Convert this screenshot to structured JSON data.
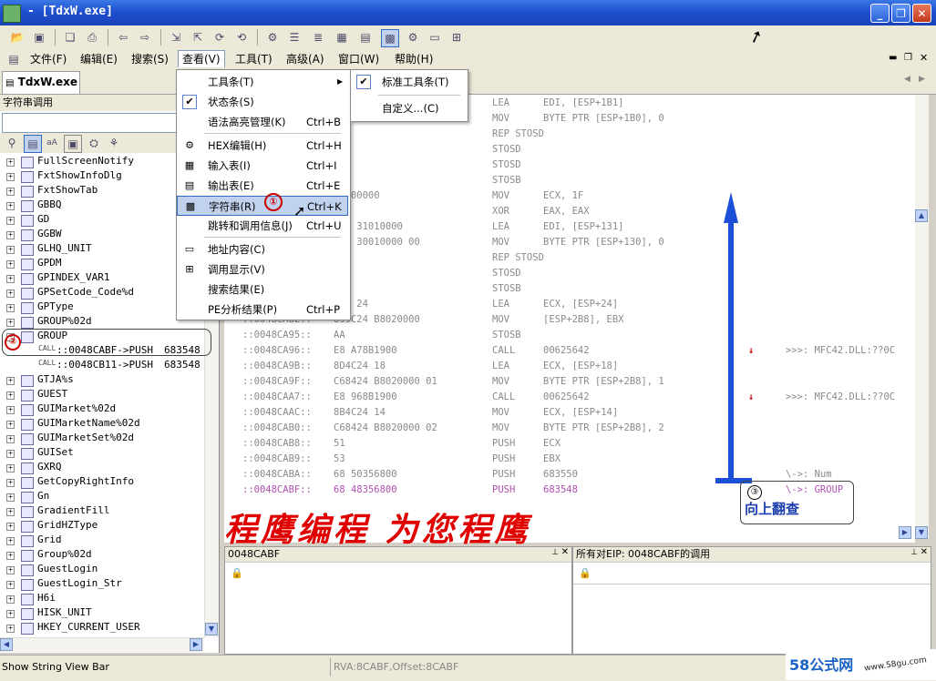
{
  "window": {
    "title": "- [TdxW.exe]"
  },
  "menubar": [
    "文件(F)",
    "编辑(E)",
    "搜索(S)",
    "查看(V)",
    "工具(T)",
    "高级(A)",
    "窗口(W)",
    "帮助(H)"
  ],
  "doc_tab": "TdxW.exe",
  "left_panel": {
    "title": "字符串调用",
    "tree": [
      "FullScreenNotify",
      "FxtShowInfoDlg",
      "FxtShowTab",
      "GBBQ",
      "GD",
      "GGBW",
      "GLHQ_UNIT",
      "GPDM",
      "GPINDEX_VAR1",
      "GPSetCode_Code%d",
      "GPType",
      "GROUP%02d"
    ],
    "group_label": "GROUP",
    "group_children": [
      {
        "tag": "CALL",
        "text": "::0048CABF->PUSH",
        "value": "683548"
      },
      {
        "tag": "CALL",
        "text": "::0048CB11->PUSH",
        "value": "683548"
      }
    ],
    "tree_after": [
      "GTJA%s",
      "GUEST",
      "GUIMarket%02d",
      "GUIMarketName%02d",
      "GUIMarketSet%02d",
      "GUISet",
      "GXRQ",
      "GetCopyRightInfo",
      "Gn",
      "GradientFill",
      "GridHZType",
      "Grid",
      "Group%02d",
      "GuestLogin",
      "GuestLogin_Str",
      "H6i",
      "HISK_UNIT",
      "HKEY_CURRENT_USER"
    ]
  },
  "view_menu": {
    "items": [
      {
        "label": "工具条(T)",
        "shortcut": "",
        "icon": "arrow-right-icon",
        "kind": "submenu"
      },
      {
        "label": "状态条(S)",
        "shortcut": "",
        "icon": "check-icon",
        "kind": "check"
      },
      {
        "label": "语法高亮管理(K)",
        "shortcut": "Ctrl+B",
        "icon": "",
        "kind": "plain"
      },
      {
        "label": "HEX编辑(H)",
        "shortcut": "Ctrl+H",
        "icon": "hex-icon",
        "kind": "plain"
      },
      {
        "label": "输入表(I)",
        "shortcut": "Ctrl+I",
        "icon": "import-icon",
        "kind": "plain"
      },
      {
        "label": "输出表(E)",
        "shortcut": "Ctrl+E",
        "icon": "export-icon",
        "kind": "plain"
      },
      {
        "label": "字符串(R)",
        "shortcut": "Ctrl+K",
        "icon": "string-icon",
        "kind": "highlight"
      },
      {
        "label": "跳转和调用信息(J)",
        "shortcut": "Ctrl+U",
        "icon": "",
        "kind": "plain"
      },
      {
        "label": "地址内容(C)",
        "shortcut": "",
        "icon": "address-icon",
        "kind": "plain"
      },
      {
        "label": "调用显示(V)",
        "shortcut": "",
        "icon": "call-icon",
        "kind": "plain"
      },
      {
        "label": "搜索结果(E)",
        "shortcut": "",
        "icon": "",
        "kind": "plain"
      },
      {
        "label": "PE分析结果(P)",
        "shortcut": "Ctrl+P",
        "icon": "",
        "kind": "plain"
      }
    ]
  },
  "submenu": {
    "items": [
      "标准工具条(T)",
      "自定义...(C)"
    ]
  },
  "code": [
    {
      "addr": "",
      "bytes": "",
      "mn": "LEA",
      "op": "EDI, [ESP+1B1]",
      "cmt": ""
    },
    {
      "addr": "",
      "bytes": "",
      "mn": "MOV",
      "op": "BYTE PTR [ESP+1B0], 0",
      "cmt": ""
    },
    {
      "addr": "",
      "bytes": "",
      "mn": "REP STOSD",
      "op": "",
      "cmt": ""
    },
    {
      "addr": "",
      "bytes": "",
      "mn": "STOSD",
      "op": "",
      "cmt": ""
    },
    {
      "addr": "",
      "bytes": "AB",
      "mn": "STOSD",
      "op": "",
      "cmt": ""
    },
    {
      "addr": "",
      "bytes": "",
      "mn": "STOSB",
      "op": "",
      "cmt": ""
    },
    {
      "addr": "",
      "bytes": "1F000000",
      "mn": "MOV",
      "op": "ECX, 1F",
      "cmt": ""
    },
    {
      "addr": "",
      "bytes": "",
      "mn": "XOR",
      "op": "EAX, EAX",
      "cmt": ""
    },
    {
      "addr": "",
      "bytes": "C24 31010000",
      "mn": "LEA",
      "op": "EDI, [ESP+131]",
      "cmt": ""
    },
    {
      "addr": "",
      "bytes": "424 30010000 00",
      "mn": "MOV",
      "op": "BYTE PTR [ESP+130], 0",
      "cmt": ""
    },
    {
      "addr": "",
      "bytes": "",
      "mn": "REP STOSD",
      "op": "",
      "cmt": ""
    },
    {
      "addr": "",
      "bytes": "",
      "mn": "STOSD",
      "op": "",
      "cmt": ""
    },
    {
      "addr": "",
      "bytes": "AB",
      "mn": "STOSB",
      "op": "",
      "cmt": ""
    },
    {
      "addr": "",
      "bytes": "C24 24",
      "mn": "LEA",
      "op": "ECX, [ESP+24]",
      "cmt": ""
    },
    {
      "addr": "::0048CA8E::",
      "bytes": "899C24 B8020000",
      "mn": "MOV",
      "op": "[ESP+2B8], EBX",
      "cmt": ""
    },
    {
      "addr": "::0048CA95::",
      "bytes": "AA",
      "mn": "STOSB",
      "op": "",
      "cmt": ""
    },
    {
      "addr": "::0048CA96::",
      "bytes": "E8 A78B1900",
      "mn": "CALL",
      "op": "00625642",
      "cmt": ">>>: MFC42.DLL:??0C"
    },
    {
      "addr": "::0048CA9B::",
      "bytes": "8D4C24 18",
      "mn": "LEA",
      "op": "ECX, [ESP+18]",
      "cmt": ""
    },
    {
      "addr": "::0048CA9F::",
      "bytes": "C68424 B8020000 01",
      "mn": "MOV",
      "op": "BYTE PTR [ESP+2B8], 1",
      "cmt": ""
    },
    {
      "addr": "::0048CAA7::",
      "bytes": "E8 968B1900",
      "mn": "CALL",
      "op": "00625642",
      "cmt": ">>>: MFC42.DLL:??0C"
    },
    {
      "addr": "::0048CAAC::",
      "bytes": "8B4C24 14",
      "mn": "MOV",
      "op": "ECX, [ESP+14]",
      "cmt": ""
    },
    {
      "addr": "::0048CAB0::",
      "bytes": "C68424 B8020000 02",
      "mn": "MOV",
      "op": "BYTE PTR [ESP+2B8], 2",
      "cmt": ""
    },
    {
      "addr": "::0048CAB8::",
      "bytes": "51",
      "mn": "PUSH",
      "op": "ECX",
      "cmt": ""
    },
    {
      "addr": "::0048CAB9::",
      "bytes": "53",
      "mn": "PUSH",
      "op": "EBX",
      "cmt": ""
    },
    {
      "addr": "::0048CABA::",
      "bytes": "68 50356800",
      "mn": "PUSH",
      "op": "683550",
      "cmt": "\\->: Num"
    },
    {
      "addr": "::0048CABF::",
      "bytes": "68 48356800",
      "mn": "PUSH",
      "op": "683548",
      "cmt": "\\->: GROUP"
    }
  ],
  "panes": {
    "left_title": "0048CABF",
    "right_title": "所有对EIP: 0048CABF的调用"
  },
  "status": {
    "message": "Show String View Bar",
    "rva": "RVA:8CABF,Offset:8CABF"
  },
  "annotations": {
    "n1": "①",
    "n2": "②",
    "n3": "③",
    "up_label": "向上翻查",
    "watermark": "程鹰编程 为您程鹰",
    "logo_main": "58公式网",
    "logo_url": "www.58gu.com"
  },
  "colors": {
    "titlebar": "#1f4fcf",
    "highlight_row": "#b050b0",
    "arrow": "#1c4fd8",
    "annotation": "#cc0000"
  }
}
